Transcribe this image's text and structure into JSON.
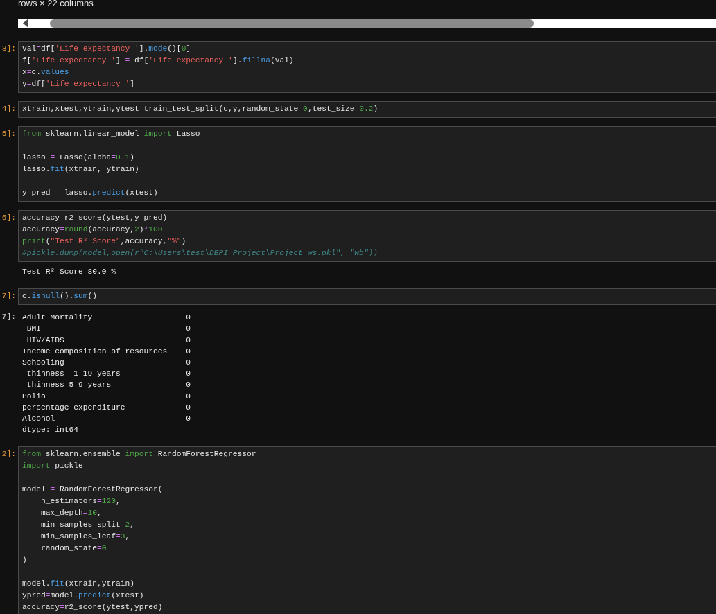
{
  "output_header": "rows × 22 columns",
  "cells": [
    {
      "prompt": "3]:",
      "lines": [
        {
          "tokens": [
            {
              "text": "val",
              "kind": "name"
            },
            {
              "text": "=",
              "kind": "op"
            },
            {
              "text": "df[",
              "kind": "name"
            },
            {
              "text": "'Life expectancy '",
              "kind": "str"
            },
            {
              "text": "].",
              "kind": "name"
            },
            {
              "text": "mode",
              "kind": "func"
            },
            {
              "text": "()[",
              "kind": "name"
            },
            {
              "text": "0",
              "kind": "num"
            },
            {
              "text": "]",
              "kind": "name"
            }
          ]
        },
        {
          "tokens": [
            {
              "text": "f[",
              "kind": "name"
            },
            {
              "text": "'Life expectancy '",
              "kind": "str"
            },
            {
              "text": "] ",
              "kind": "name"
            },
            {
              "text": "=",
              "kind": "op"
            },
            {
              "text": " df[",
              "kind": "name"
            },
            {
              "text": "'Life expectancy '",
              "kind": "str"
            },
            {
              "text": "].",
              "kind": "name"
            },
            {
              "text": "fillna",
              "kind": "func"
            },
            {
              "text": "(val)",
              "kind": "name"
            }
          ]
        },
        {
          "tokens": [
            {
              "text": "x",
              "kind": "name"
            },
            {
              "text": "=",
              "kind": "op"
            },
            {
              "text": "c.",
              "kind": "name"
            },
            {
              "text": "values",
              "kind": "func"
            }
          ]
        },
        {
          "tokens": [
            {
              "text": "y",
              "kind": "name"
            },
            {
              "text": "=",
              "kind": "op"
            },
            {
              "text": "df[",
              "kind": "name"
            },
            {
              "text": "'Life expectancy '",
              "kind": "str"
            },
            {
              "text": "]",
              "kind": "name"
            }
          ]
        }
      ]
    },
    {
      "prompt": "4]:",
      "lines": [
        {
          "tokens": [
            {
              "text": "xtrain,xtest,ytrain,ytest",
              "kind": "name"
            },
            {
              "text": "=",
              "kind": "op"
            },
            {
              "text": "train_test_split(c,y,random_state",
              "kind": "name"
            },
            {
              "text": "=",
              "kind": "op"
            },
            {
              "text": "0",
              "kind": "num"
            },
            {
              "text": ",test_size",
              "kind": "name"
            },
            {
              "text": "=",
              "kind": "op"
            },
            {
              "text": "0.2",
              "kind": "num"
            },
            {
              "text": ")",
              "kind": "name"
            }
          ]
        }
      ]
    },
    {
      "prompt": "5]:",
      "lines": [
        {
          "tokens": [
            {
              "text": "from",
              "kind": "kw"
            },
            {
              "text": " sklearn.linear_model ",
              "kind": "name"
            },
            {
              "text": "import",
              "kind": "kw"
            },
            {
              "text": " Lasso",
              "kind": "name"
            }
          ]
        },
        {
          "kind": "blank"
        },
        {
          "tokens": [
            {
              "text": "lasso ",
              "kind": "name"
            },
            {
              "text": "=",
              "kind": "op"
            },
            {
              "text": " Lasso(alpha",
              "kind": "name"
            },
            {
              "text": "=",
              "kind": "op"
            },
            {
              "text": "0.1",
              "kind": "num"
            },
            {
              "text": ")",
              "kind": "name"
            }
          ]
        },
        {
          "tokens": [
            {
              "text": "lasso.",
              "kind": "name"
            },
            {
              "text": "fit",
              "kind": "func"
            },
            {
              "text": "(xtrain, ytrain)",
              "kind": "name"
            }
          ]
        },
        {
          "kind": "blank"
        },
        {
          "tokens": [
            {
              "text": "y_pred ",
              "kind": "name"
            },
            {
              "text": "=",
              "kind": "op"
            },
            {
              "text": " lasso.",
              "kind": "name"
            },
            {
              "text": "predict",
              "kind": "func"
            },
            {
              "text": "(xtest)",
              "kind": "name"
            }
          ]
        }
      ]
    },
    {
      "prompt": "6]:",
      "lines": [
        {
          "tokens": [
            {
              "text": "accuracy",
              "kind": "name"
            },
            {
              "text": "=",
              "kind": "op"
            },
            {
              "text": "r2_score(ytest,y_pred)",
              "kind": "name"
            }
          ]
        },
        {
          "tokens": [
            {
              "text": "accuracy",
              "kind": "name"
            },
            {
              "text": "=",
              "kind": "op"
            },
            {
              "text": "round",
              "kind": "builtin"
            },
            {
              "text": "(accuracy,",
              "kind": "name"
            },
            {
              "text": "2",
              "kind": "num"
            },
            {
              "text": ")",
              "kind": "name"
            },
            {
              "text": "*",
              "kind": "op"
            },
            {
              "text": "100",
              "kind": "num"
            }
          ]
        },
        {
          "tokens": [
            {
              "text": "print",
              "kind": "builtin"
            },
            {
              "text": "(",
              "kind": "name"
            },
            {
              "text": "\"Test R² Score\"",
              "kind": "str"
            },
            {
              "text": ",accuracy,",
              "kind": "name"
            },
            {
              "text": "\"%\"",
              "kind": "str"
            },
            {
              "text": ")",
              "kind": "name"
            }
          ]
        },
        {
          "tokens": [
            {
              "text": "#pickle.dump(model,open(r\"C:\\Users\\test\\DEPI Project\\Project ws.pkl\", \"wb\"))",
              "kind": "comment"
            }
          ]
        }
      ],
      "output": {
        "kind": "stream",
        "lines": [
          "Test R² Score 80.0 %"
        ]
      }
    },
    {
      "prompt": "7]:",
      "lines": [
        {
          "tokens": [
            {
              "text": "c.",
              "kind": "name"
            },
            {
              "text": "isnull",
              "kind": "func"
            },
            {
              "text": "().",
              "kind": "name"
            },
            {
              "text": "sum",
              "kind": "func"
            },
            {
              "text": "()",
              "kind": "name"
            }
          ]
        }
      ],
      "output": {
        "kind": "series",
        "prompt": "7]:",
        "rows": [
          {
            "label": "Adult Mortality",
            "value": "0"
          },
          {
            "label": " BMI",
            "value": "0"
          },
          {
            "label": " HIV/AIDS",
            "value": "0"
          },
          {
            "label": "Income composition of resources",
            "value": "0"
          },
          {
            "label": "Schooling",
            "value": "0"
          },
          {
            "label": " thinness  1-19 years",
            "value": "0"
          },
          {
            "label": " thinness 5-9 years",
            "value": "0"
          },
          {
            "label": "Polio",
            "value": "0"
          },
          {
            "label": "percentage expenditure",
            "value": "0"
          },
          {
            "label": "Alcohol",
            "value": "0"
          }
        ],
        "footer": "dtype: int64"
      }
    },
    {
      "prompt": "2]:",
      "lines": [
        {
          "tokens": [
            {
              "text": "from",
              "kind": "kw"
            },
            {
              "text": " sklearn.ensemble ",
              "kind": "name"
            },
            {
              "text": "import",
              "kind": "kw"
            },
            {
              "text": " RandomForestRegressor",
              "kind": "name"
            }
          ]
        },
        {
          "tokens": [
            {
              "text": "import",
              "kind": "kw"
            },
            {
              "text": " pickle",
              "kind": "name"
            }
          ]
        },
        {
          "kind": "blank"
        },
        {
          "tokens": [
            {
              "text": "model ",
              "kind": "name"
            },
            {
              "text": "=",
              "kind": "op"
            },
            {
              "text": " RandomForestRegressor(",
              "kind": "name"
            }
          ]
        },
        {
          "tokens": [
            {
              "text": "    n_estimators",
              "kind": "name"
            },
            {
              "text": "=",
              "kind": "op"
            },
            {
              "text": "120",
              "kind": "num"
            },
            {
              "text": ",",
              "kind": "name"
            }
          ]
        },
        {
          "tokens": [
            {
              "text": "    max_depth",
              "kind": "name"
            },
            {
              "text": "=",
              "kind": "op"
            },
            {
              "text": "10",
              "kind": "num"
            },
            {
              "text": ",",
              "kind": "name"
            }
          ]
        },
        {
          "tokens": [
            {
              "text": "    min_samples_split",
              "kind": "name"
            },
            {
              "text": "=",
              "kind": "op"
            },
            {
              "text": "2",
              "kind": "num"
            },
            {
              "text": ",",
              "kind": "name"
            }
          ]
        },
        {
          "tokens": [
            {
              "text": "    min_samples_leaf",
              "kind": "name"
            },
            {
              "text": "=",
              "kind": "op"
            },
            {
              "text": "3",
              "kind": "num"
            },
            {
              "text": ",",
              "kind": "name"
            }
          ]
        },
        {
          "tokens": [
            {
              "text": "    random_state",
              "kind": "name"
            },
            {
              "text": "=",
              "kind": "op"
            },
            {
              "text": "0",
              "kind": "num"
            }
          ]
        },
        {
          "tokens": [
            {
              "text": ")",
              "kind": "name"
            }
          ]
        },
        {
          "kind": "blank"
        },
        {
          "tokens": [
            {
              "text": "model.",
              "kind": "name"
            },
            {
              "text": "fit",
              "kind": "func"
            },
            {
              "text": "(xtrain,ytrain)",
              "kind": "name"
            }
          ]
        },
        {
          "tokens": [
            {
              "text": "ypred",
              "kind": "name"
            },
            {
              "text": "=",
              "kind": "op"
            },
            {
              "text": "model.",
              "kind": "name"
            },
            {
              "text": "predict",
              "kind": "func"
            },
            {
              "text": "(xtest)",
              "kind": "name"
            }
          ]
        },
        {
          "tokens": [
            {
              "text": "accuracy",
              "kind": "name"
            },
            {
              "text": "=",
              "kind": "op"
            },
            {
              "text": "r2_score(ytest,ypred)",
              "kind": "name"
            }
          ]
        }
      ]
    }
  ]
}
